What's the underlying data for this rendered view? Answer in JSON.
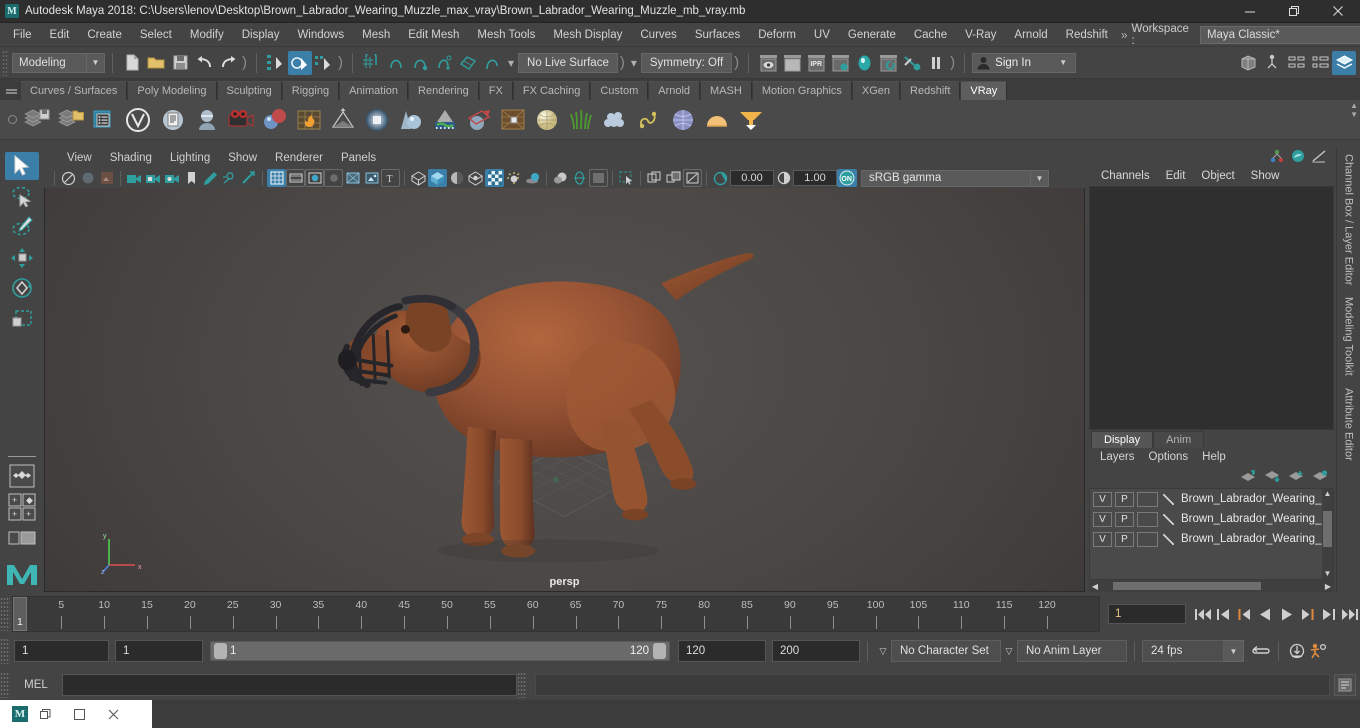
{
  "window": {
    "title": "Autodesk Maya 2018: C:\\Users\\lenov\\Desktop\\Brown_Labrador_Wearing_Muzzle_max_vray\\Brown_Labrador_Wearing_Muzzle_mb_vray.mb",
    "logo": "M",
    "minimize": "minimize-icon",
    "restore": "restore-icon",
    "close": "close-icon"
  },
  "menubar": {
    "items": [
      "File",
      "Edit",
      "Create",
      "Select",
      "Modify",
      "Display",
      "Windows",
      "Mesh",
      "Edit Mesh",
      "Mesh Tools",
      "Mesh Display",
      "Curves",
      "Surfaces",
      "Deform",
      "UV",
      "Generate",
      "Cache",
      "V-Ray",
      "Arnold",
      "Redshift"
    ],
    "overflow": "»",
    "workspace_label": "Workspace :",
    "workspace_value": "Maya Classic*"
  },
  "statusbar": {
    "mode_value": "Modeling",
    "live_surface": "No Live Surface",
    "symmetry": "Symmetry: Off",
    "sign_in": "Sign In",
    "ipr_label": "IPR"
  },
  "shelf": {
    "tabs": [
      "Curves / Surfaces",
      "Poly Modeling",
      "Sculpting",
      "Rigging",
      "Animation",
      "Rendering",
      "FX",
      "FX Caching",
      "Custom",
      "Arnold",
      "MASH",
      "Motion Graphics",
      "XGen",
      "Redshift",
      "VRay"
    ],
    "active_tab": "VRay"
  },
  "viewport": {
    "menus": [
      "View",
      "Shading",
      "Lighting",
      "Show",
      "Renderer",
      "Panels"
    ],
    "exposure": "0.00",
    "gamma_value": "1.00",
    "color_profile": "sRGB gamma",
    "camera_label": "persp",
    "axis": {
      "x": "x",
      "y": "y",
      "z": "z"
    }
  },
  "right_panel": {
    "tabs": [
      "Channels",
      "Edit",
      "Object",
      "Show"
    ],
    "side_labels": [
      "Channel Box / Layer Editor",
      "Modeling Toolkit",
      "Attribute Editor"
    ],
    "layer_tabs": [
      "Display",
      "Anim"
    ],
    "active_layer_tab": "Display",
    "layer_menus": [
      "Layers",
      "Options",
      "Help"
    ],
    "layers": [
      {
        "visible": "V",
        "playback": "P",
        "name": "Brown_Labrador_Wearing_M"
      },
      {
        "visible": "V",
        "playback": "P",
        "name": "Brown_Labrador_Wearing_M"
      },
      {
        "visible": "V",
        "playback": "P",
        "name": "Brown_Labrador_Wearing_M"
      }
    ]
  },
  "timeline": {
    "ticks": [
      5,
      10,
      15,
      20,
      25,
      30,
      35,
      40,
      45,
      50,
      55,
      60,
      65,
      70,
      75,
      80,
      85,
      90,
      95,
      100,
      105,
      110,
      115,
      120
    ],
    "start": 1,
    "end": 120,
    "current_frame": "1",
    "current_field": "1",
    "playback_buttons": [
      "go-to-start",
      "step-back-keyframe",
      "step-back-frame",
      "play-backwards",
      "play-forwards",
      "step-forward-frame",
      "step-forward-keyframe",
      "go-to-end"
    ]
  },
  "range": {
    "anim_start": "1",
    "range_start": "1",
    "slider_min": "1",
    "slider_max": "120",
    "range_end": "120",
    "anim_end": "200",
    "character_set": "No Character Set",
    "anim_layer": "No Anim Layer",
    "fps": "24 fps"
  },
  "command_line": {
    "label": "MEL",
    "input_value": "",
    "output_value": ""
  },
  "taskbar": {
    "app_icon": "M",
    "restore_icon": "restore-icon",
    "maximize_icon": "maximize-icon",
    "close_icon": "close-icon"
  },
  "colors": {
    "accent": "#3b7fa8",
    "panel_bg": "#444444",
    "title_bg": "#2e2e2e",
    "field_bg": "#2b2b2b",
    "teal": "#2f9e9e",
    "orange": "#e08a3a"
  }
}
